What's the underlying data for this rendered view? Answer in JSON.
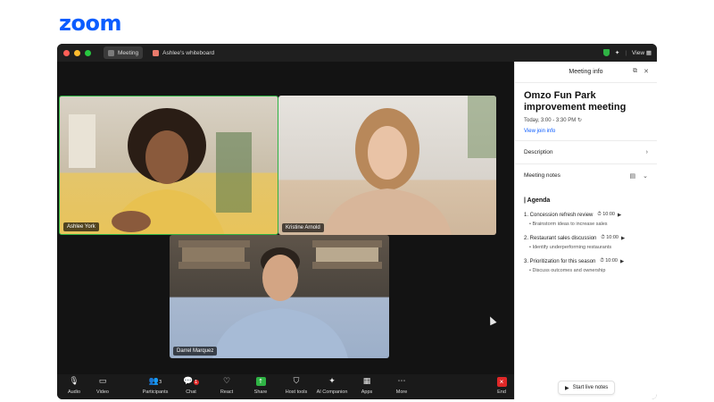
{
  "brand": {
    "logo_text": "zoom",
    "color": "#0b5cff"
  },
  "titlebar": {
    "tabs": [
      {
        "label": "Meeting",
        "active": true
      },
      {
        "label": "Ashlee's whiteboard",
        "active": false
      }
    ],
    "view_label": "View"
  },
  "participants": [
    {
      "name": "Ashlee York",
      "speaking": true
    },
    {
      "name": "Kristine Arnold",
      "speaking": false
    },
    {
      "name": "Darrel Marquez",
      "speaking": false
    }
  ],
  "toolbar": {
    "audio": "Audio",
    "video": "Video",
    "participants": "Participants",
    "participants_count": "3",
    "chat": "Chat",
    "chat_badge": "1",
    "react": "React",
    "share": "Share",
    "host_tools": "Host tools",
    "ai_companion": "AI Companion",
    "apps": "Apps",
    "more": "More",
    "end": "End"
  },
  "panel": {
    "header": "Meeting info",
    "title": "Omzo Fun Park improvement meeting",
    "time": "Today, 3:00 - 3:30 PM",
    "join_info": "View join info",
    "description": "Description",
    "meeting_notes": "Meeting notes",
    "agenda_heading": "| Agenda",
    "agenda": [
      {
        "title": "1. Concession refresh review",
        "timer": "10:00",
        "sub": "Brainstorm ideas to increase sales"
      },
      {
        "title": "2. Restaurant sales discussion",
        "timer": "10:00",
        "sub": "Identify underperforming restaurants"
      },
      {
        "title": "3. Prioritization for this season",
        "timer": "10:00",
        "sub": "Discuss outcomes and ownership"
      }
    ],
    "start_live_notes": "Start live notes"
  },
  "colors": {
    "speaking_border": "#2fb344",
    "end_button": "#e02828",
    "link": "#0b5cff"
  }
}
